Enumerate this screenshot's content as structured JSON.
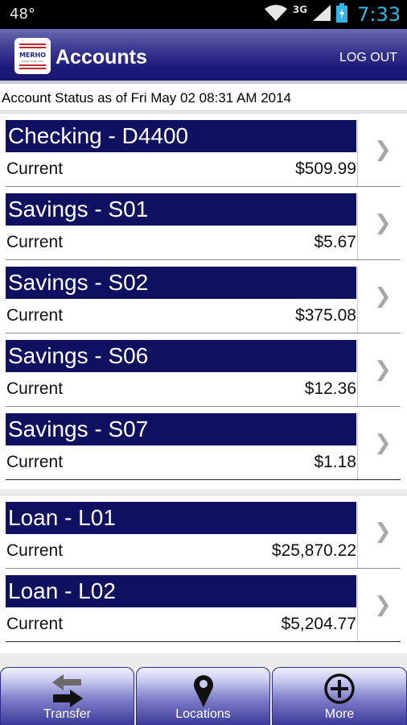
{
  "status_bar": {
    "temperature": "48°",
    "network": "3G",
    "time": "7:33"
  },
  "header": {
    "title": "Accounts",
    "logout_label": "LOG OUT",
    "logo_text": "MERHO",
    "logo_subtext": "Federal Credit Union"
  },
  "status_line": "Account Status as of Fri May 02 08:31 AM 2014",
  "groups": [
    {
      "accounts": [
        {
          "name": "Checking - D4400",
          "label": "Current",
          "amount": "$509.99"
        },
        {
          "name": "Savings - S01",
          "label": "Current",
          "amount": "$5.67"
        },
        {
          "name": "Savings - S02",
          "label": "Current",
          "amount": "$375.08"
        },
        {
          "name": "Savings - S06",
          "label": "Current",
          "amount": "$12.36"
        },
        {
          "name": "Savings - S07",
          "label": "Current",
          "amount": "$1.18"
        }
      ]
    },
    {
      "accounts": [
        {
          "name": "Loan - L01",
          "label": "Current",
          "amount": "$25,870.22"
        },
        {
          "name": "Loan - L02",
          "label": "Current",
          "amount": "$5,204.77"
        }
      ]
    }
  ],
  "bottom_tabs": [
    {
      "label": "Transfer",
      "icon": "transfer-arrows-icon"
    },
    {
      "label": "Locations",
      "icon": "location-pin-icon"
    },
    {
      "label": "More",
      "icon": "plus-circle-icon"
    }
  ],
  "colors": {
    "header": "#17156e",
    "account_bar": "#101060",
    "clock": "#33b5e5"
  }
}
